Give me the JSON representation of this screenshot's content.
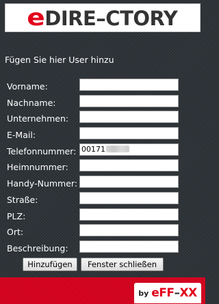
{
  "header": {
    "logo_prefix": "e",
    "logo_rest": "DIRE–CTORY"
  },
  "form": {
    "title": "Fügen Sie hier User hinzu",
    "fields": [
      {
        "label": "Vorname:",
        "value": ""
      },
      {
        "label": "Nachname:",
        "value": ""
      },
      {
        "label": "Unternehmen:",
        "value": ""
      },
      {
        "label": "E-Mail:",
        "value": ""
      },
      {
        "label": "Telefonnummer:",
        "value": "00171"
      },
      {
        "label": "Heimnummer:",
        "value": ""
      },
      {
        "label": "Handy-Nummer:",
        "value": ""
      },
      {
        "label": "Straße:",
        "value": ""
      },
      {
        "label": "PLZ:",
        "value": ""
      },
      {
        "label": "Ort:",
        "value": ""
      },
      {
        "label": "Beschreibung:",
        "value": ""
      }
    ],
    "add_button": "Hinzufügen",
    "close_button": "Fenster schließen"
  },
  "footer": {
    "by_label": "by",
    "brand_red": "eFF",
    "brand_mid": "–",
    "brand_end": "XX"
  },
  "colors": {
    "brand_red": "#e3001b",
    "background": "#2e3338",
    "footer": "#d1001c"
  }
}
